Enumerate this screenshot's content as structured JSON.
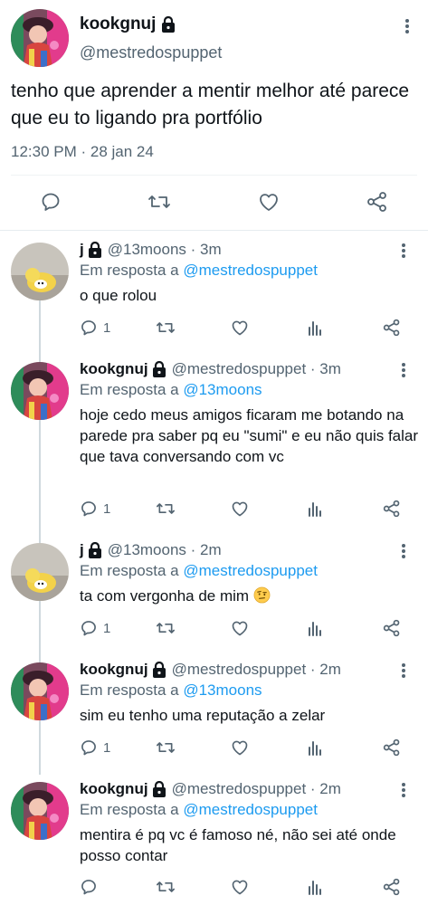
{
  "main": {
    "name": "kookgnuj",
    "handle": "@mestredospuppet",
    "text": "tenho que aprender a mentir melhor até parece que eu to ligando pra portfólio",
    "timestamp": "12:30 PM · 28 jan 24"
  },
  "replies": [
    {
      "name": "j",
      "handle": "@13moons · 3m",
      "in_reply_prefix": "Em resposta a",
      "in_reply_to": "@mestredospuppet",
      "text": "o que rolou",
      "reply_count": "1",
      "avatar": "duck"
    },
    {
      "name": "kookgnuj",
      "handle": "@mestredospuppet · 3m",
      "in_reply_prefix": "Em resposta a",
      "in_reply_to": "@13moons",
      "text": "hoje cedo meus amigos ficaram me botando na parede pra saber pq eu \"sumi\" e eu não quis falar que tava conversando com vc",
      "reply_count": "1",
      "avatar": "clown"
    },
    {
      "name": "j",
      "handle": "@13moons · 2m",
      "in_reply_prefix": "Em resposta a",
      "in_reply_to": "@mestredospuppet",
      "text": "ta com vergonha de mim",
      "emoji": "raised-eyebrow-emoji",
      "reply_count": "1",
      "avatar": "duck"
    },
    {
      "name": "kookgnuj",
      "handle": "@mestredospuppet · 2m",
      "in_reply_prefix": "Em resposta a",
      "in_reply_to": "@13moons",
      "text": "sim eu tenho uma reputação a zelar",
      "reply_count": "1",
      "avatar": "clown"
    },
    {
      "name": "kookgnuj",
      "handle": "@mestredospuppet · 2m",
      "in_reply_prefix": "Em resposta a",
      "in_reply_to": "@mestredospuppet",
      "text": "mentira é pq vc é famoso né, não sei até onde posso contar",
      "reply_count": "",
      "avatar": "clown"
    }
  ],
  "colors": {
    "text": "#0f1419",
    "secondary": "#536471",
    "link": "#1d9bf0"
  }
}
